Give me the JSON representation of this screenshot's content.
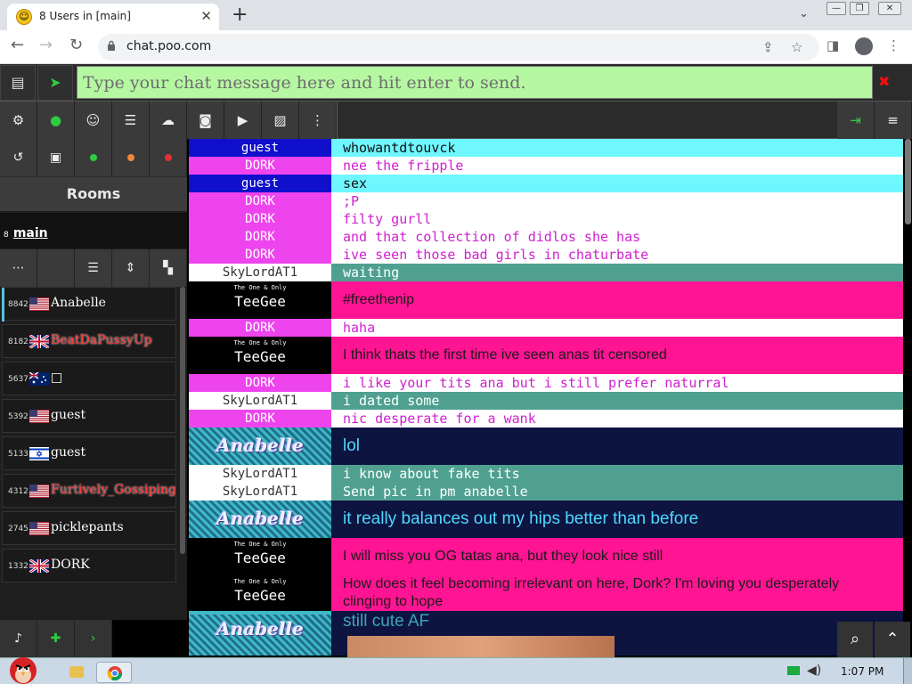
{
  "browser": {
    "tab_title": "8 Users in [main]",
    "url": "chat.poo.com",
    "window_controls": [
      "minimize",
      "restore",
      "close"
    ]
  },
  "message_bar": {
    "placeholder": "Type your chat message here and hit enter to send."
  },
  "rooms": {
    "header": "Rooms",
    "active_room_count": "8",
    "active_room_name": "main"
  },
  "users": [
    {
      "id": "8842",
      "flag": "us",
      "name": "Anabelle",
      "color": "#ffffff"
    },
    {
      "id": "8182",
      "flag": "gb",
      "name": "BeatDaPussyUp",
      "color": "#ff3333"
    },
    {
      "id": "5637",
      "flag": "au",
      "name": "□",
      "color": "#ffffff"
    },
    {
      "id": "5392",
      "flag": "us",
      "name": "guest",
      "color": "#ffffff"
    },
    {
      "id": "5133",
      "flag": "il",
      "name": "guest",
      "color": "#ffffff"
    },
    {
      "id": "4312",
      "flag": "us",
      "name": "Furtively_Gossiping",
      "color": "#ff3333"
    },
    {
      "id": "2745",
      "flag": "us",
      "name": "picklepants",
      "color": "#ffffff"
    },
    {
      "id": "1332",
      "flag": "gb",
      "name": "DORK",
      "color": "#ffffff"
    }
  ],
  "messages": [
    {
      "nick": "guest",
      "text": "whowantdtouvck"
    },
    {
      "nick": "DORK",
      "text": "nee the fripple"
    },
    {
      "nick": "guest",
      "text": "sex"
    },
    {
      "nick": "DORK",
      "text": ";P"
    },
    {
      "nick": "DORK",
      "text": "filty gurll"
    },
    {
      "nick": "DORK",
      "text": "and that collection of didlos she has"
    },
    {
      "nick": "DORK",
      "text": "ive seen those bad girls in chaturbate"
    },
    {
      "nick": "SkyLordAT1",
      "text": "waiting"
    },
    {
      "nick_small": "The One & Only",
      "nick": "TeeGee",
      "text": "#freethenip"
    },
    {
      "nick": "DORK",
      "text": "haha"
    },
    {
      "nick_small": "The One & Only",
      "nick": "TeeGee",
      "text": "I think thats the first time ive seen anas tit censored"
    },
    {
      "nick": "DORK",
      "text": "i like your tits ana but i still prefer naturral"
    },
    {
      "nick": "SkyLordAT1",
      "text": "i dated some"
    },
    {
      "nick": "DORK",
      "text": "nic desperate for a wank"
    },
    {
      "nick": "Anabelle",
      "text": "lol"
    },
    {
      "nick": "SkyLordAT1",
      "text": "i know about fake tits"
    },
    {
      "nick": "SkyLordAT1",
      "text": "Send pic in pm anabelle"
    },
    {
      "nick": "Anabelle",
      "text": "it really balances out my hips better than before"
    },
    {
      "nick_small": "The One & Only",
      "nick": "TeeGee",
      "text": "I will miss you OG tatas ana, but they look nice still"
    },
    {
      "nick_small": "The One & Only",
      "nick": "TeeGee",
      "text": "How does it feel becoming irrelevant on here, Dork? I'm loving you desperately clinging to hope"
    },
    {
      "nick": "Anabelle",
      "text": "still cute AF"
    }
  ],
  "colors": {
    "input_bg": "#b6f7a2",
    "guest_nick_bg": "#1010cc",
    "guest_msg_bg": "#6ff7ff",
    "dork_nick_bg": "#ee44ee",
    "dork_msg_color": "#d020d0",
    "sky_msg_bg": "#4fa090",
    "teegee_msg_bg": "#ff1493",
    "anabelle_msg_bg": "#0d1440",
    "anabelle_text": "#4fd8ff"
  },
  "taskbar": {
    "time": "1:07 PM"
  }
}
